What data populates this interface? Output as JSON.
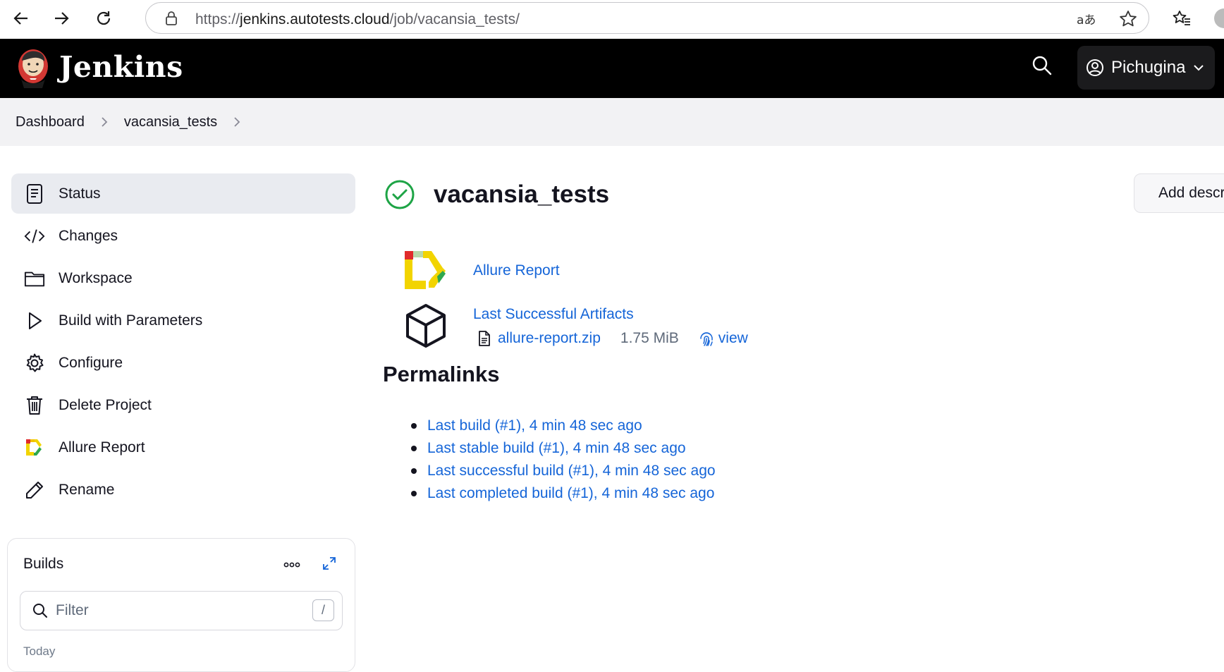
{
  "browser": {
    "url_scheme": "https://",
    "url_host": "jenkins.autotests.cloud",
    "url_path": "/job/vacansia_tests/"
  },
  "header": {
    "brand": "Jenkins",
    "user": "Pichugina"
  },
  "breadcrumb": [
    "Dashboard",
    "vacansia_tests"
  ],
  "sidebar": {
    "items": [
      {
        "label": "Status",
        "icon": "status-icon",
        "active": true
      },
      {
        "label": "Changes",
        "icon": "code-icon"
      },
      {
        "label": "Workspace",
        "icon": "folder-icon"
      },
      {
        "label": "Build with Parameters",
        "icon": "play-icon"
      },
      {
        "label": "Configure",
        "icon": "gear-icon"
      },
      {
        "label": "Delete Project",
        "icon": "trash-icon"
      },
      {
        "label": "Allure Report",
        "icon": "allure-icon"
      },
      {
        "label": "Rename",
        "icon": "pencil-icon"
      }
    ]
  },
  "builds": {
    "title": "Builds",
    "filter_placeholder": "Filter",
    "shortcut": "/",
    "today": "Today"
  },
  "main": {
    "title": "vacansia_tests",
    "add_description": "Add description",
    "allure_report": "Allure Report",
    "last_successful_artifacts": "Last Successful Artifacts",
    "artifact_name": "allure-report.zip",
    "artifact_size": "1.75 MiB",
    "artifact_view": "view",
    "permalinks_title": "Permalinks",
    "permalinks": [
      "Last build (#1), 4 min 48 sec ago",
      "Last stable build (#1), 4 min 48 sec ago",
      "Last successful build (#1), 4 min 48 sec ago",
      "Last completed build (#1), 4 min 48 sec ago"
    ]
  },
  "colors": {
    "header_bg": "#000000",
    "link": "#1565d8",
    "success": "#1ea446",
    "active_item_bg": "#e9ebf0"
  }
}
